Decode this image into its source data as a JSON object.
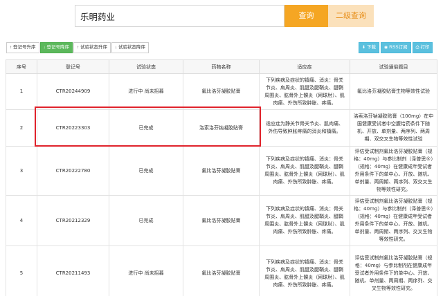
{
  "search": {
    "value": "乐明药业",
    "search_label": "查询",
    "second_search_label": "二级查询"
  },
  "sort_buttons": [
    {
      "icon": "arrow-up-icon",
      "glyph": "↑",
      "label": "登记号升序",
      "active": false
    },
    {
      "icon": "arrow-down-icon",
      "glyph": "↓",
      "label": "登记号降序",
      "active": true
    },
    {
      "icon": "arrow-up-icon",
      "glyph": "↑",
      "label": "试验状态升序",
      "active": false
    },
    {
      "icon": "arrow-down-icon",
      "glyph": "↓",
      "label": "试验状态降序",
      "active": false
    }
  ],
  "tool_buttons": [
    {
      "icon": "download-icon",
      "glyph": "⬇",
      "label": "下载"
    },
    {
      "icon": "rss-icon",
      "glyph": "◉",
      "label": "RSS订阅"
    },
    {
      "icon": "print-icon",
      "glyph": "⎙",
      "label": "打印"
    }
  ],
  "table": {
    "headers": [
      "序号",
      "登记号",
      "试验状态",
      "药物名称",
      "适应症",
      "试验通俗题目"
    ],
    "rows": [
      {
        "no": "1",
        "reg": "CTR20244909",
        "status": "进行中 尚未招募",
        "drug": "氟比洛芬凝胶贴膏",
        "indication": "下列疾病及症状的镇痛、消炎：骨关节炎、肩周炎、肌腱及腱鞘炎、腱鞘周围炎、肱骨外上髁炎（网球肘）、肌肉痛、外伤所致肿胀、疼痛。",
        "title": "氟比洛芬凝胶贴膏生物等效性试验"
      },
      {
        "no": "2",
        "reg": "CTR20223303",
        "status": "已完成",
        "drug": "洛索洛芬钠凝胶贴膏",
        "indication": "适应症为静关节骨关节炎、肌肉痛、外伤导致肿胀疼痛的消炎和镇痛。",
        "title": "洛索洛芬钠凝胶贴膏（100mg）在中国健康受试者中空腹给药条件下随机、开放、单剂量、两序列、两周期、双交叉生物等效性试验"
      },
      {
        "no": "3",
        "reg": "CTR20222780",
        "status": "已完成",
        "drug": "氟比洛芬凝胶贴膏",
        "indication": "下列疾病及症状的镇痛、消炎：骨关节炎、肩周炎、肌腱及腱鞘炎、腱鞘周围炎、肱骨外上髁炎（网球肘）、肌肉痛、外伤所致肿胀、疼痛。",
        "title": "评估受试制剂氟比洛芬凝胶贴膏（规格：40mg）与参比制剂（泽普思®）（规格：40mg）在健康成年受试者外用条件下的单中心、开放、随机、单剂量、两周期、两序列、双交叉生物等效性研究。"
      },
      {
        "no": "4",
        "reg": "CTR20212329",
        "status": "已完成",
        "drug": "氟比洛芬凝胶贴膏",
        "indication": "下列疾病及症状的镇痛、消炎：骨关节炎、肩周炎、肌腱及腱鞘炎、腱鞘周围炎、肱骨外上髁炎（网球肘）、肌肉痛、外伤所致肿胀、疼痛。",
        "title": "评估受试制剂氟比洛芬凝胶贴膏（规格：40mg）与参比制剂（泽普思®）（规格：40mg）在健康成年受试者外用条件下的单中心、开放、随机、单剂量、两周期、两序列、交叉生物等效性研究。"
      },
      {
        "no": "5",
        "reg": "CTR20211493",
        "status": "进行中 尚未招募",
        "drug": "氟比洛芬凝胶贴膏",
        "indication": "下列疾病及症状的镇痛、消炎：骨关节炎、肩周炎、肌腱及腱鞘炎、腱鞘周围炎、肱骨外上髁炎（网球肘）、肌肉痛、外伤所致肿胀、疼痛。",
        "title": "评估受试制剂氟比洛芬凝胶贴膏（规格：40mg）与参比制剂在健康成年受试者外用条件下的单中心、开放、随机、单剂量、两周期、两序列、交叉生物等效性研究。"
      }
    ]
  },
  "colors": {
    "search_button": "#f5a623",
    "second_search_button": "#fbe1bb",
    "active_sort": "#5cb85c",
    "tool_button": "#5bc0de",
    "highlight": "#e0222b"
  }
}
